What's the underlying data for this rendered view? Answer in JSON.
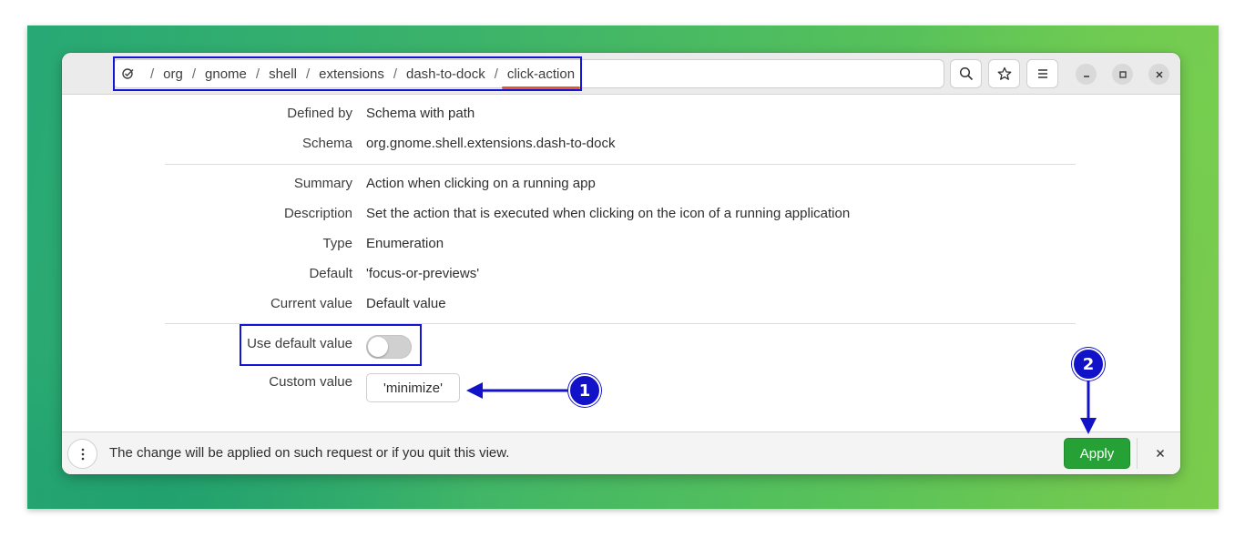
{
  "breadcrumb": {
    "icon": "dconf-icon",
    "segments": [
      "org",
      "gnome",
      "shell",
      "extensions",
      "dash-to-dock",
      "click-action"
    ],
    "separator": "/"
  },
  "header": {
    "search_icon": "search-icon",
    "bookmark_icon": "star-icon",
    "menu_icon": "hamburger-menu-icon"
  },
  "key_info": {
    "defined_by": {
      "label": "Defined by",
      "value": "Schema with path"
    },
    "schema": {
      "label": "Schema",
      "value": "org.gnome.shell.extensions.dash-to-dock"
    },
    "summary": {
      "label": "Summary",
      "value": "Action when clicking on a running app"
    },
    "description": {
      "label": "Description",
      "value": "Set the action that is executed when clicking on the icon of a running application"
    },
    "type": {
      "label": "Type",
      "value": "Enumeration"
    },
    "default": {
      "label": "Default",
      "value": "'focus-or-previews'"
    },
    "current_value": {
      "label": "Current value",
      "value": "Default value"
    }
  },
  "controls": {
    "use_default": {
      "label": "Use default value",
      "checked": false
    },
    "custom_value": {
      "label": "Custom value",
      "value": "'minimize'"
    }
  },
  "footer": {
    "message": "The change will be applied on such request or if you quit this view.",
    "apply_label": "Apply"
  },
  "annotations": {
    "marker_1": "1",
    "marker_2": "2"
  },
  "colors": {
    "accent_apply": "#26a135",
    "annotation_blue": "#1212c8",
    "tab_underline": "#e05a2b"
  }
}
